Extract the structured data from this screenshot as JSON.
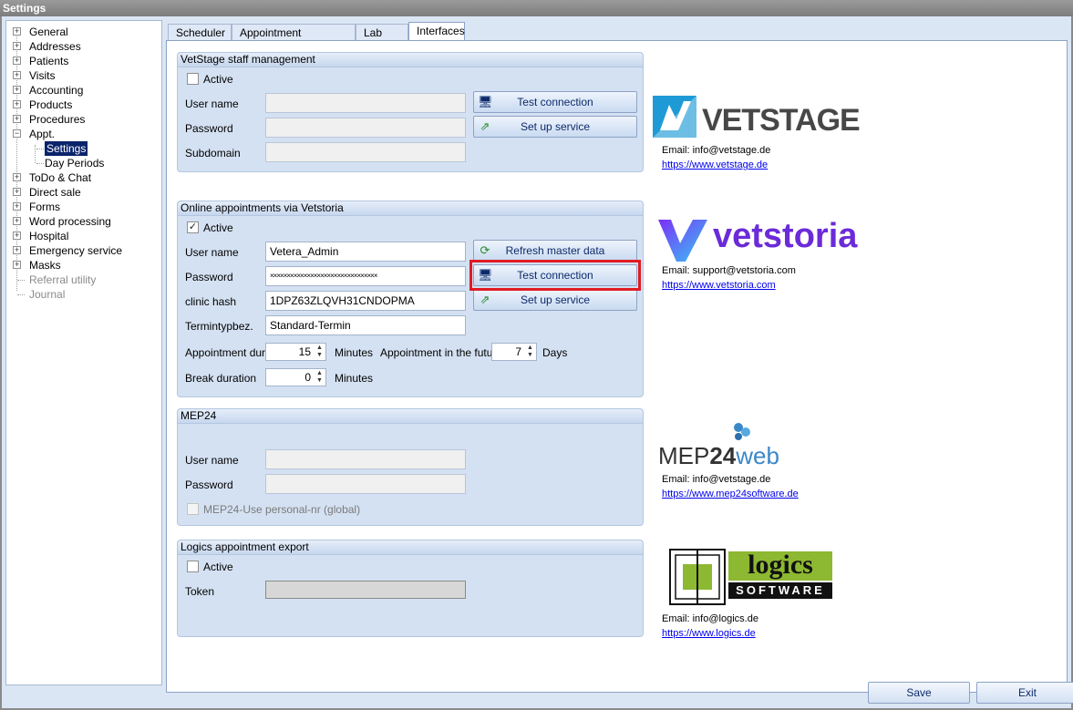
{
  "window": {
    "title": "Settings"
  },
  "tree": {
    "items": [
      {
        "label": "General"
      },
      {
        "label": "Addresses"
      },
      {
        "label": "Patients"
      },
      {
        "label": "Visits"
      },
      {
        "label": "Accounting"
      },
      {
        "label": "Products"
      },
      {
        "label": "Procedures"
      },
      {
        "label": "Appt."
      },
      {
        "label": "Settings"
      },
      {
        "label": "Day Periods"
      },
      {
        "label": "ToDo & Chat"
      },
      {
        "label": "Direct sale"
      },
      {
        "label": "Forms"
      },
      {
        "label": "Word processing"
      },
      {
        "label": "Hospital"
      },
      {
        "label": "Emergency service"
      },
      {
        "label": "Masks"
      },
      {
        "label": "Referral utility"
      },
      {
        "label": "Journal"
      }
    ],
    "expand_glyph": "+",
    "collapse_glyph": "−"
  },
  "tabs": [
    {
      "label": "Scheduler"
    },
    {
      "label": "Appointment scheduling"
    },
    {
      "label": "Lab Tab"
    },
    {
      "label": "Interfaces"
    }
  ],
  "vetstage": {
    "title": "VetStage staff management",
    "active_label": "Active",
    "active_checked": false,
    "username_label": "User name",
    "username_value": "",
    "password_label": "Password",
    "password_value": "",
    "subdomain_label": "Subdomain",
    "subdomain_value": "",
    "test_connection": "Test connection",
    "setup_service": "Set up service",
    "logo_text": "VETSTAGE",
    "email": "Email: info@vetstage.de",
    "url": "https://www.vetstage.de"
  },
  "vetstoria": {
    "title": "Online appointments via Vetstoria",
    "active_label": "Active",
    "active_checked": true,
    "check_glyph": "✓",
    "username_label": "User name",
    "username_value": "Vetera_Admin",
    "password_label": "Password",
    "password_value": "××××××××××××××××××××××××××××××××",
    "clinic_hash_label": "clinic hash",
    "clinic_hash_value": "1DPZ63ZLQVH31CNDOPMA",
    "termintyp_label": "Termintypbez.",
    "termintyp_value": "Standard-Termin",
    "duration_label": "Appointment duration",
    "duration_value": "15",
    "duration_unit": "Minutes",
    "future_label": "Appointment in the future",
    "future_value": "7",
    "future_unit": "Days",
    "break_label": "Break duration",
    "break_value": "0",
    "break_unit": "Minutes",
    "refresh_master": "Refresh master data",
    "test_connection": "Test connection",
    "setup_service": "Set up service",
    "logo_text": "vetstoria",
    "email": "Email: support@vetstoria.com",
    "url": "https://www.vetstoria.com"
  },
  "mep24": {
    "title": "MEP24",
    "username_label": "User name",
    "username_value": "",
    "password_label": "Password",
    "password_value": "",
    "personal_nr_label": "MEP24-Use personal-nr (global)",
    "logo_text_a": "MEP",
    "logo_text_b": "24",
    "logo_text_c": "web",
    "email": "Email: info@vetstage.de",
    "url": "https://www.mep24software.de"
  },
  "logics": {
    "title": "Logics appointment export",
    "active_label": "Active",
    "active_checked": false,
    "token_label": "Token",
    "token_value": "",
    "logo_text_a": "logics",
    "logo_text_b": "SOFTWARE",
    "email": "Email: info@logics.de",
    "url": "https://www.logics.de"
  },
  "footer": {
    "save": "Save",
    "exit": "Exit"
  },
  "icons": {
    "computer": "🖥",
    "refresh": "⟳",
    "setup": "⇗",
    "spin_up": "▲",
    "spin_down": "▼"
  },
  "colors": {
    "highlight": "#e01b24",
    "vetstage_blue": "#1e9bd7",
    "vetstoria_purple": "#6b2bd9",
    "logics_green": "#8db832"
  }
}
